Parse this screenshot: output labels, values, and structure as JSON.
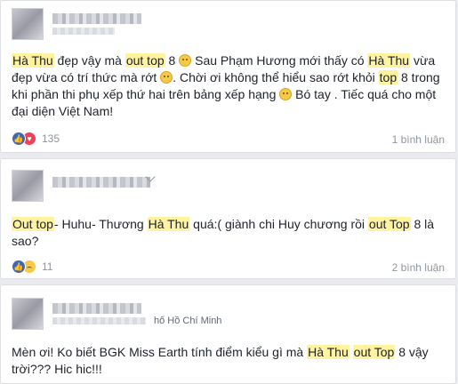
{
  "posts": [
    {
      "paragraph_html": "<span class=\"hl\">Hà Thu</span> đẹp vậy mà <span class=\"hl\">out top</span> 8 <span class=\"emoji\" data-name=\"upside-down-face-emoji\" data-interactable=\"false\"></span> Sau Phạm Hương mới thấy có <span class=\"hl\">Hà Thu</span> vừa đẹp vừa có trí thức mà rớt <span class=\"emoji\" data-name=\"confused-face-emoji\" data-interactable=\"false\"></span>. Chời ơi không thể hiểu sao rớt khỏi <span class=\"hl\">top</span> 8 trong khi phần thi phụ xếp thứ hai trên bảng xếp hạng <span class=\"emoji\" data-name=\"sad-face-emoji\" data-interactable=\"false\"></span> Bó tay . Tiếc quá cho một đại diện Việt Nam!",
      "reactions": [
        "like",
        "love"
      ],
      "reaction_count": "135",
      "comment_count": "1 bình luận"
    },
    {
      "paragraph_html": "<span class=\"hl\">Out top</span>- Huhu- Thương <span class=\"hl\">Hà Thu</span> quá:( giành chi Huy chương rồi <span class=\"hl\">out Top</span> 8 là sao?",
      "reactions": [
        "like",
        "sad"
      ],
      "reaction_count": "11",
      "comment_count": "2 bình luận"
    },
    {
      "location": "hố Hồ Chí Minh",
      "paragraph_html": "Mèn ơi! Ko biết BGK Miss Earth tính điểm kiểu gì mà <span class=\"hl\">Hà Thu</span> <span class=\"hl\">out Top</span> 8 vậy trời??? Hic hic!!!"
    }
  ],
  "colors": {
    "highlight": "#fff3a0",
    "like": "#4267b2",
    "love": "#f33e58",
    "sad": "#f7c948"
  }
}
